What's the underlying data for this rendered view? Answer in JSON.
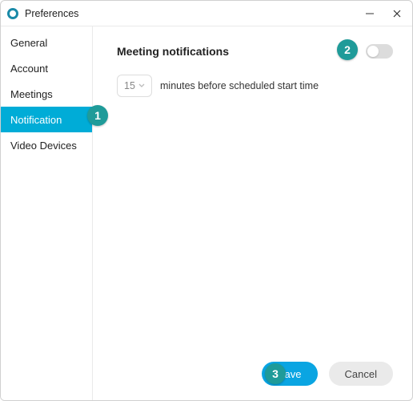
{
  "window": {
    "title": "Preferences"
  },
  "sidebar": {
    "items": [
      {
        "label": "General"
      },
      {
        "label": "Account"
      },
      {
        "label": "Meetings"
      },
      {
        "label": "Notification"
      },
      {
        "label": "Video Devices"
      }
    ],
    "activeIndex": 3
  },
  "content": {
    "section_title": "Meeting notifications",
    "toggle_on": false,
    "minutes_value": "15",
    "minutes_hint": "minutes before scheduled start time"
  },
  "footer": {
    "save_label": "Save",
    "cancel_label": "Cancel"
  },
  "callouts": {
    "one": "1",
    "two": "2",
    "three": "3"
  },
  "colors": {
    "accent": "#00acd7",
    "primary_btn": "#0aa5e2",
    "callout": "#1f9b99"
  }
}
